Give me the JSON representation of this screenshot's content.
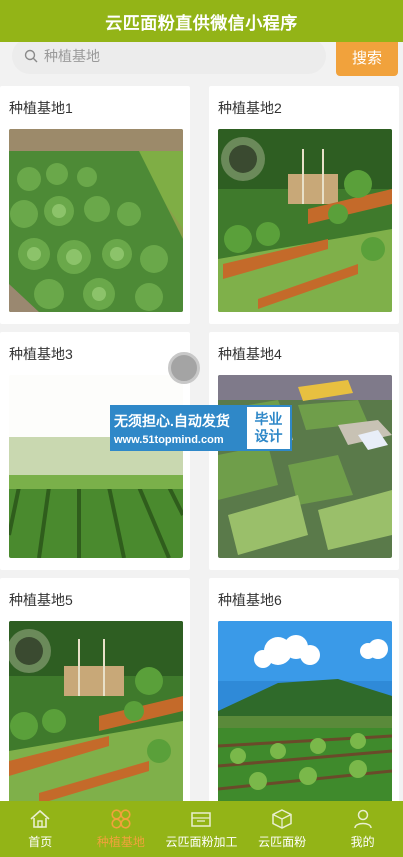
{
  "header": {
    "title": "云匹面粉直供微信小程序"
  },
  "search": {
    "placeholder": "种植基地",
    "button_label": "搜索"
  },
  "cards": [
    {
      "title": "种植基地1"
    },
    {
      "title": "种植基地2"
    },
    {
      "title": "种植基地3"
    },
    {
      "title": "种植基地4"
    },
    {
      "title": "种植基地5"
    },
    {
      "title": "种植基地6"
    }
  ],
  "watermark": {
    "line1": "无须担心.自动发货",
    "line2": "www.51topmind.com",
    "badge_line1": "毕业",
    "badge_line2": "设计"
  },
  "tabbar": {
    "items": [
      {
        "label": "首页",
        "icon": "home-icon"
      },
      {
        "label": "种植基地",
        "icon": "clover-icon",
        "active": true
      },
      {
        "label": "云匹面粉加工",
        "icon": "factory-icon"
      },
      {
        "label": "云匹面粉",
        "icon": "box-icon"
      },
      {
        "label": "我的",
        "icon": "user-icon"
      }
    ]
  },
  "colors": {
    "brand": "#93b417",
    "accent": "#f1a23c",
    "watermark": "#2f88c8"
  }
}
